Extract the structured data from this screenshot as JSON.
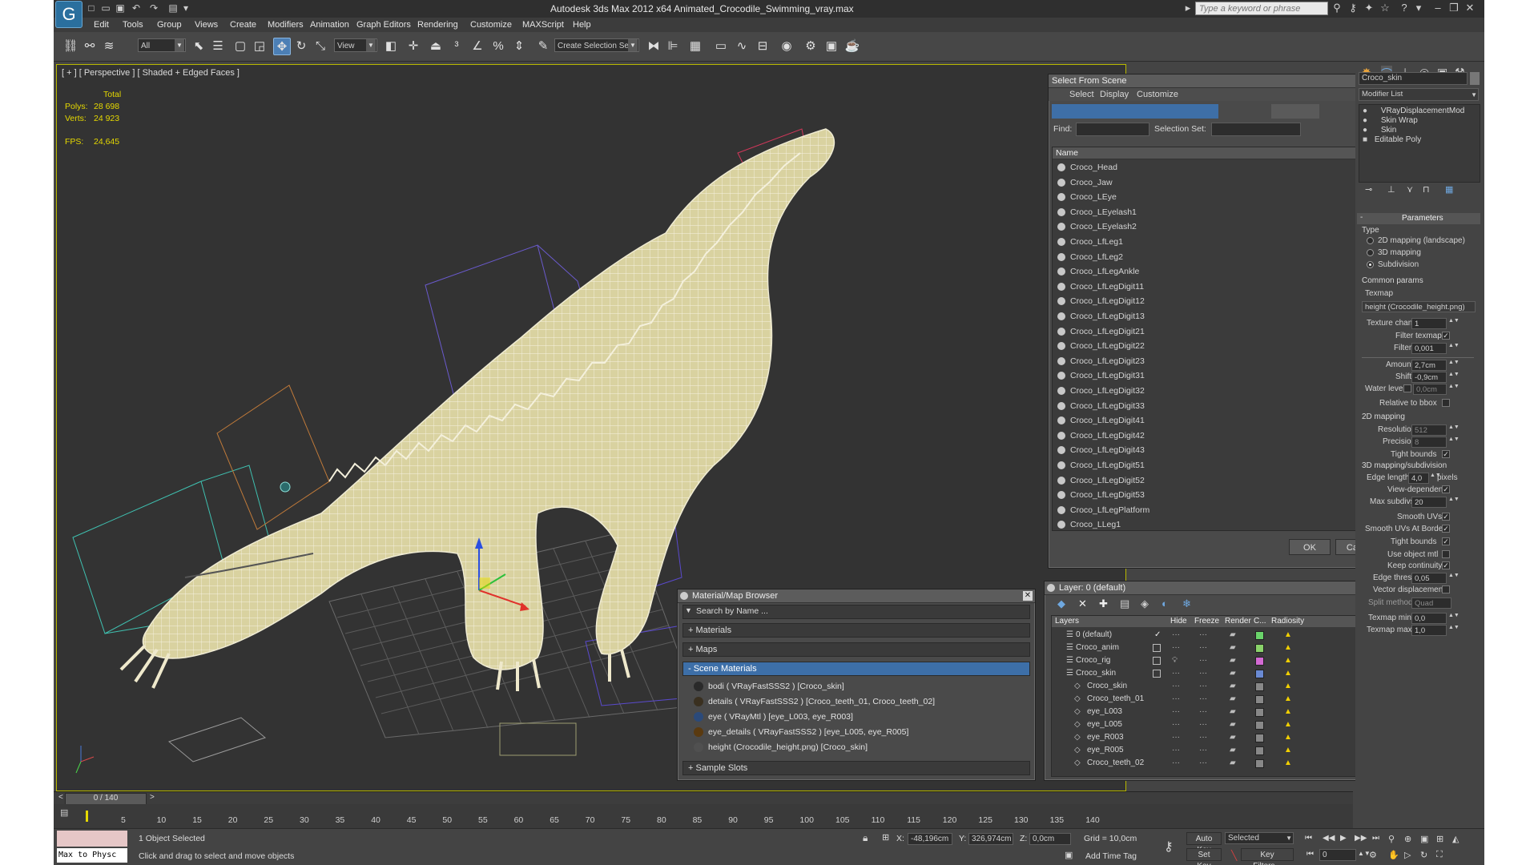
{
  "app": {
    "title": "Autodesk 3ds Max  2012 x64     Animated_Crocodile_Swimming_vray.max"
  },
  "titlebar": {
    "search_placeholder": "Type a keyword or phrase"
  },
  "menu": [
    "Edit",
    "Tools",
    "Group",
    "Views",
    "Create",
    "Modifiers",
    "Animation",
    "Graph Editors",
    "Rendering",
    "Customize",
    "MAXScript",
    "Help"
  ],
  "toolbar": {
    "filter_value": "All",
    "refcoord_value": "View",
    "named_selection_value": "Create Selection Se"
  },
  "viewport": {
    "label": "[ + ] [ Perspective ] [ Shaded + Edged Faces ]",
    "stats": {
      "total_label": "Total",
      "polys_label": "Polys:",
      "polys_value": "28 698",
      "verts_label": "Verts:",
      "verts_value": "24 923",
      "fps_label": "FPS:",
      "fps_value": "24,645"
    }
  },
  "select_from_scene": {
    "title": "Select From Scene",
    "menus": [
      "Select",
      "Display",
      "Customize"
    ],
    "find_label": "Find:",
    "selection_set_label": "Selection Set:",
    "column_name": "Name",
    "items": [
      "Croco_Head",
      "Croco_Jaw",
      "Croco_LEye",
      "Croco_LEyelash1",
      "Croco_LEyelash2",
      "Croco_LfLeg1",
      "Croco_LfLeg2",
      "Croco_LfLegAnkle",
      "Croco_LfLegDigit11",
      "Croco_LfLegDigit12",
      "Croco_LfLegDigit13",
      "Croco_LfLegDigit21",
      "Croco_LfLegDigit22",
      "Croco_LfLegDigit23",
      "Croco_LfLegDigit31",
      "Croco_LfLegDigit32",
      "Croco_LfLegDigit33",
      "Croco_LfLegDigit41",
      "Croco_LfLegDigit42",
      "Croco_LfLegDigit43",
      "Croco_LfLegDigit51",
      "Croco_LfLegDigit52",
      "Croco_LfLegDigit53",
      "Croco_LfLegPlatform",
      "Croco_LLeg1"
    ],
    "ok_label": "OK",
    "cancel_label": "Cancel"
  },
  "material_browser": {
    "title": "Material/Map Browser",
    "search_placeholder": "Search by Name ...",
    "sections": {
      "materials": "+ Materials",
      "maps": "+ Maps",
      "scene_materials": "- Scene Materials",
      "sample_slots": "+ Sample Slots"
    },
    "items": [
      "bodi  ( VRayFastSSS2 )  [Croco_skin]",
      "details  ( VRayFastSSS2 )  [Croco_teeth_01, Croco_teeth_02]",
      "eye  ( VRayMtl )  [eye_L003, eye_R003]",
      "eye_details  ( VRayFastSSS2 )  [eye_L005, eye_R005]",
      "height (Crocodile_height.png)  [Croco_skin]"
    ]
  },
  "layer_manager": {
    "title": "Layer: 0 (default)",
    "columns": {
      "layers": "Layers",
      "hide": "Hide",
      "freeze": "Freeze",
      "render": "Render",
      "color": "C...",
      "radiosity": "Radiosity"
    },
    "rows": [
      "0 (default)",
      "Croco_anim",
      "Croco_rig",
      "Croco_skin",
      "Croco_skin",
      "Croco_teeth_01",
      "eye_L003",
      "eye_L005",
      "eye_R003",
      "eye_R005",
      "Croco_teeth_02"
    ]
  },
  "command_panel": {
    "object_name": "Croco_skin",
    "modifier_list_label": "Modifier List",
    "stack": [
      "VRayDisplacementMod",
      "Skin Wrap",
      "Skin",
      "Editable Poly"
    ],
    "rollout_title": "Parameters",
    "type_label": "Type",
    "type_options": [
      "2D mapping (landscape)",
      "3D mapping",
      "Subdivision"
    ],
    "common_params_label": "Common params",
    "texmap_label": "Texmap",
    "texmap_value": "height (Crocodile_height.png)",
    "texture_chan_label": "Texture chan",
    "texture_chan_value": "1",
    "filter_texmap_label": "Filter texmap",
    "filter_blur_label": "Filter blur",
    "filter_blur_value": "0,001",
    "amount_label": "Amount",
    "amount_value": "2,7cm",
    "shift_label": "Shift",
    "shift_value": "-0,9cm",
    "water_level_label": "Water level",
    "water_level_value": "0,0cm",
    "relative_bbox_label": "Relative to bbox",
    "mapping2d_label": "2D mapping",
    "resolution_label": "Resolution",
    "resolution_value": "512",
    "precision_label": "Precision",
    "precision_value": "8",
    "tight_bounds_label": "Tight bounds",
    "mapping3d_label": "3D mapping/subdivision",
    "edge_length_label": "Edge length",
    "edge_length_value": "4,0",
    "pixels_label": "pixels",
    "view_dependent_label": "View-dependent",
    "max_subdivs_label": "Max subdivs",
    "max_subdivs_value": "20",
    "smooth_uvs_label": "Smooth UVs",
    "smooth_uvs_borders_label": "Smooth UVs At Borders",
    "tight_bounds2_label": "Tight bounds",
    "use_object_mtl_label": "Use object mtl",
    "keep_continuity_label": "Keep continuity",
    "edge_thresh_label": "Edge thresh",
    "edge_thresh_value": "0,05",
    "vector_displacement_label": "Vector displacement",
    "split_method_label": "Split method:",
    "split_method_value": "Quad",
    "texmap_min_label": "Texmap min:",
    "texmap_min_value": "0,0",
    "texmap_max_label": "Texmap max:",
    "texmap_max_value": "1,0"
  },
  "timeline": {
    "frame_counter": "0 / 140",
    "ticks": [
      "5",
      "10",
      "15",
      "20",
      "25",
      "30",
      "35",
      "40",
      "45",
      "50",
      "55",
      "60",
      "65",
      "70",
      "75",
      "80",
      "85",
      "90",
      "95",
      "100",
      "105",
      "110",
      "115",
      "120",
      "125",
      "130",
      "135",
      "140"
    ]
  },
  "statusbar": {
    "maxscript_label": "Max to Physc",
    "selected_text": "1 Object Selected",
    "prompt_text": "Click and drag to select and move objects",
    "x_label": "X:",
    "x_value": "-48,196cm",
    "y_label": "Y:",
    "y_value": "326,974cm",
    "z_label": "Z:",
    "z_value": "0,0cm",
    "grid_text": "Grid = 10,0cm",
    "add_time_tag": "Add Time Tag",
    "auto_key": "Auto Key",
    "set_key": "Set Key",
    "selected_dropdown": "Selected",
    "key_filters": "Key Filters...",
    "current_frame": "0"
  },
  "colors": {
    "accent": "#3d6fa8",
    "viewport_border": "#b8b800",
    "stats_text": "#e6d900",
    "wireframe_mesh": "#d9d2a0"
  }
}
